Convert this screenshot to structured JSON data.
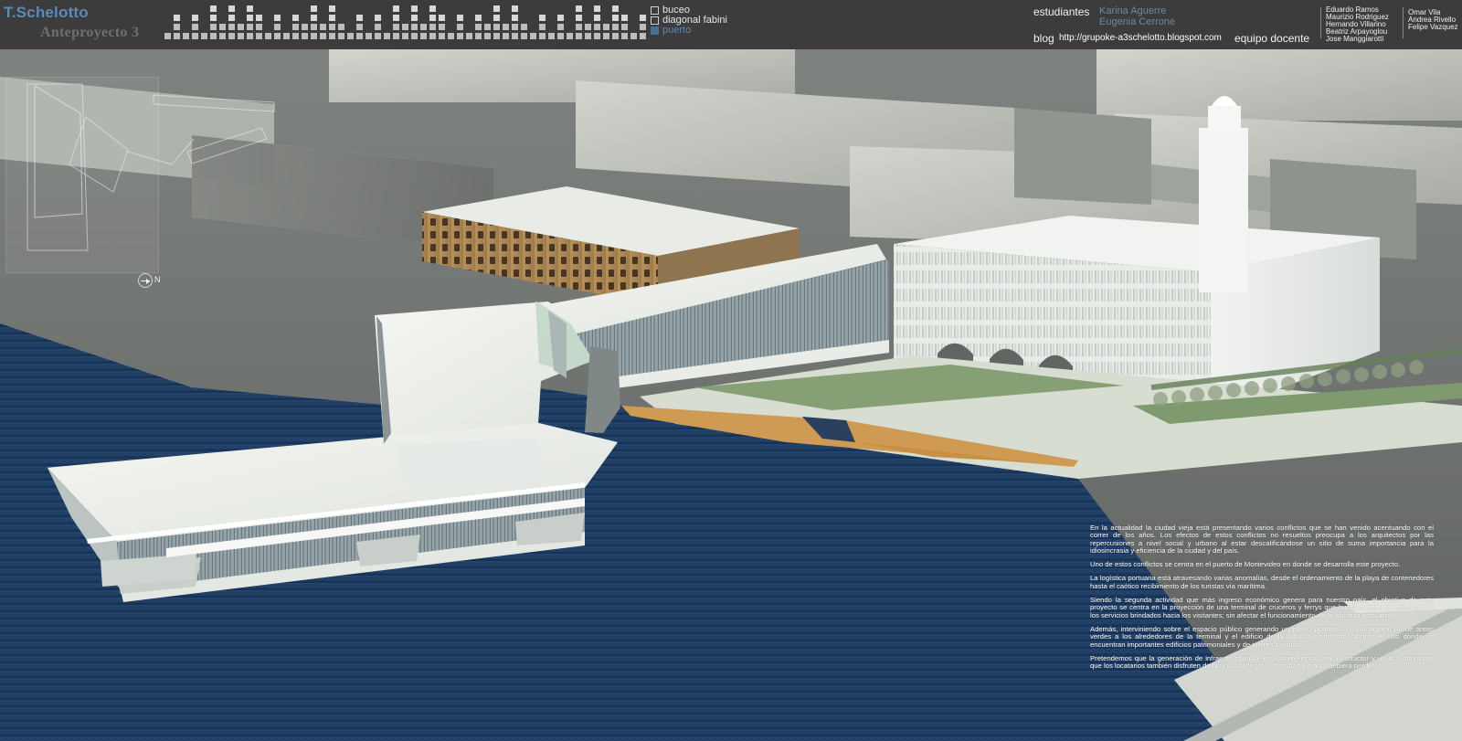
{
  "header": {
    "brand": "T.Schelotto",
    "subtitle": "Anteproyecto 3",
    "legend": [
      {
        "label": "buceo",
        "active": false
      },
      {
        "label": "diagonal fabini",
        "active": false
      },
      {
        "label": "puerto",
        "active": true
      }
    ],
    "students_label": "estudiantes",
    "students": [
      "Karina Aguerre",
      "Eugenia Cerrone"
    ],
    "blog_label": "blog",
    "blog_url": "http://grupoke-a3schelotto.blogspot.com",
    "team_label": "equipo docente",
    "teachers_primary": [
      "Eduardo Ramos",
      "Maurizio Rodriguez",
      "Hernando Villarino",
      "Beatriz Arpayoglou",
      "Jose Manggiarotti"
    ],
    "teachers_secondary": [
      "Omar Vila",
      "Andrea Rivello",
      "Felipe Vazquez"
    ]
  },
  "minimap": {
    "north_label": "N"
  },
  "description": {
    "paragraphs": [
      "En la actualidad la ciudad vieja está presentando varios conflictos que se han venido acentuando con el correr de los años. Los efectos de estos conflictos no resueltos preocupa a los arquitectos por las repercusiones a nivel social y urbano al estar descalificándose un sitio de suma importancia para la idiosincrasia y eficiencia de la ciudad y del país.",
      "Uno de estos conflictos se centra en el puerto de Montevideo en donde se desarrolla este proyecto.",
      "La logística portuaria está atravesando varias anomalías, desde el ordenamiento de la playa de contenedores hasta el caótico recibimiento de los turistas vía marítima.",
      "Siendo la segunda actividad que más ingreso económico genera para nuestro país, el objetivo de este proyecto se centra en la proyección de una terminal de cruceros y ferrys que busca mejorar la eficiencia de los servicios brindados hacia los visitantes; sin afectar el funcionamiento de la logística portuaria.",
      "Además, interviniendo sobre el espacio público generando un paseo portuario y la incorporación de áreas verdes a los alrededores de la terminal y el edificio de la Aduana se intenta calificar el sitio donde se encuentran importantes edificios patrimoniales y de interés turístico.",
      "Pretendemos que la generación de infraestructura de esta intervención sea un atractor y un activador para que los locatarios también disfruten de las cualidades que la ciudad vieja no debiera perder."
    ]
  },
  "colors": {
    "header_bg": "#3c3c3c",
    "brand": "#5b8bb8",
    "subtitle": "#6f6f6f",
    "student_names": "#6c89a5",
    "water": "#173559",
    "building": "#f1f3ef"
  }
}
